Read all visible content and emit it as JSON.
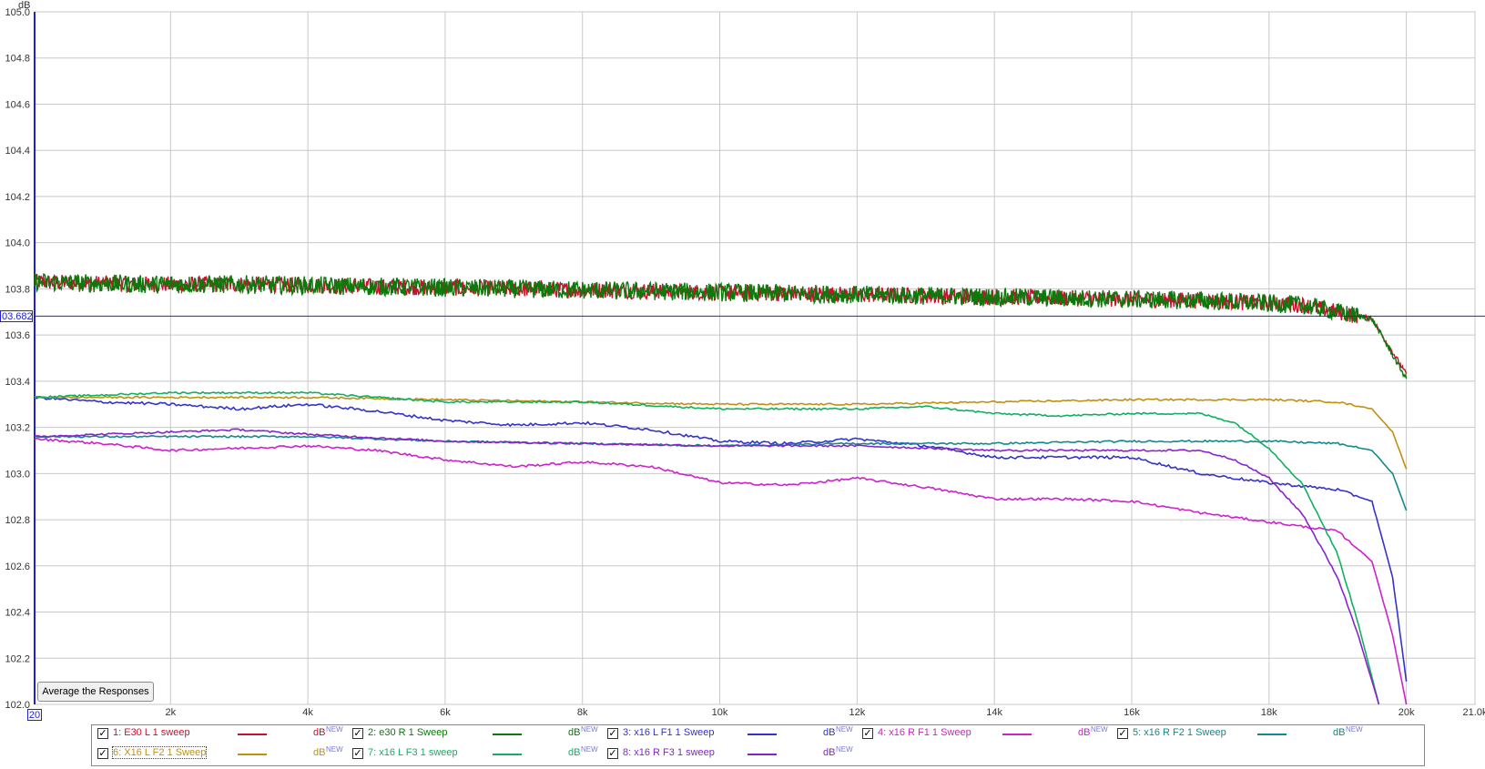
{
  "chart_data": {
    "type": "line",
    "ylabel": "dB",
    "xlim": [
      20,
      21000
    ],
    "ylim": [
      102.0,
      105.0
    ],
    "grid": true,
    "x_ticks": [
      {
        "v": 2000,
        "label": "2k"
      },
      {
        "v": 4000,
        "label": "4k"
      },
      {
        "v": 6000,
        "label": "6k"
      },
      {
        "v": 8000,
        "label": "8k"
      },
      {
        "v": 10000,
        "label": "10k"
      },
      {
        "v": 12000,
        "label": "12k"
      },
      {
        "v": 14000,
        "label": "14k"
      },
      {
        "v": 16000,
        "label": "16k"
      },
      {
        "v": 18000,
        "label": "18k"
      },
      {
        "v": 20000,
        "label": "20k"
      },
      {
        "v": 21000,
        "label": "21.0k"
      }
    ],
    "y_ticks": [
      {
        "v": 105.0,
        "label": "105.0"
      },
      {
        "v": 104.8,
        "label": "104.8"
      },
      {
        "v": 104.6,
        "label": "104.6"
      },
      {
        "v": 104.4,
        "label": "104.4"
      },
      {
        "v": 104.2,
        "label": "104.2"
      },
      {
        "v": 104.0,
        "label": "104.0"
      },
      {
        "v": 103.8,
        "label": "103.8"
      },
      {
        "v": 103.6,
        "label": "103.6"
      },
      {
        "v": 103.4,
        "label": "103.4"
      },
      {
        "v": 103.2,
        "label": "103.2"
      },
      {
        "v": 103.0,
        "label": "103.0"
      },
      {
        "v": 102.8,
        "label": "102.8"
      },
      {
        "v": 102.6,
        "label": "102.6"
      },
      {
        "v": 102.4,
        "label": "102.4"
      },
      {
        "v": 102.2,
        "label": "102.2"
      },
      {
        "v": 102.0,
        "label": "102.0"
      }
    ],
    "cursor_y": 103.682,
    "cursor_label": "03.682",
    "x_start_label": "20",
    "series": [
      {
        "name": "1: E30 L 1 sweep",
        "color": "#c8102e",
        "noise": 0.035,
        "x": [
          20,
          1500,
          3000,
          5000,
          7000,
          9000,
          11000,
          13000,
          15000,
          17000,
          18500,
          19500,
          20000
        ],
        "y": [
          103.83,
          103.82,
          103.82,
          103.81,
          103.8,
          103.79,
          103.78,
          103.77,
          103.76,
          103.75,
          103.73,
          103.67,
          103.43
        ]
      },
      {
        "name": "2: e30 R 1 Sweep",
        "color": "#0a7a0a",
        "noise": 0.04,
        "x": [
          20,
          1500,
          3000,
          5000,
          7000,
          9000,
          11000,
          13000,
          15000,
          17000,
          18500,
          19500,
          20000
        ],
        "y": [
          103.83,
          103.82,
          103.82,
          103.81,
          103.8,
          103.79,
          103.78,
          103.77,
          103.76,
          103.75,
          103.73,
          103.67,
          103.41
        ]
      },
      {
        "name": "3: x16 L F1 1 Sweep",
        "color": "#3333cc",
        "noise": 0.006,
        "x": [
          20,
          1000,
          2000,
          3000,
          4000,
          5000,
          6000,
          7000,
          8000,
          9000,
          10000,
          11000,
          12000,
          13000,
          14000,
          15000,
          16000,
          17000,
          18000,
          19000,
          19500,
          19800,
          20000
        ],
        "y": [
          103.33,
          103.31,
          103.3,
          103.28,
          103.3,
          103.27,
          103.23,
          103.21,
          103.22,
          103.19,
          103.14,
          103.13,
          103.15,
          103.12,
          103.07,
          103.07,
          103.07,
          103.0,
          102.96,
          102.93,
          102.88,
          102.55,
          102.1
        ]
      },
      {
        "name": "4: x16 R F1 1 Sweep",
        "color": "#cc22cc",
        "noise": 0.005,
        "x": [
          20,
          1000,
          2000,
          3000,
          4000,
          5000,
          6000,
          7000,
          8000,
          9000,
          10000,
          11000,
          12000,
          13000,
          14000,
          15000,
          16000,
          17000,
          18000,
          19000,
          19500,
          19800,
          20000
        ],
        "y": [
          103.15,
          103.13,
          103.1,
          103.11,
          103.12,
          103.1,
          103.06,
          103.03,
          103.05,
          103.03,
          102.96,
          102.95,
          102.98,
          102.94,
          102.89,
          102.89,
          102.88,
          102.83,
          102.79,
          102.75,
          102.62,
          102.3,
          102.0
        ]
      },
      {
        "name": "5: x16 R F2 1 Sweep",
        "color": "#128a8a",
        "noise": 0.004,
        "x": [
          20,
          2000,
          4000,
          6000,
          8000,
          10000,
          12000,
          14000,
          16000,
          18000,
          19000,
          19500,
          19800,
          20000
        ],
        "y": [
          103.16,
          103.16,
          103.16,
          103.14,
          103.13,
          103.12,
          103.13,
          103.13,
          103.14,
          103.14,
          103.13,
          103.1,
          103.0,
          102.84
        ]
      },
      {
        "name": "6: X16 L F2 1 Sweep",
        "color": "#c09010",
        "noise": 0.004,
        "x": [
          20,
          2000,
          4000,
          6000,
          8000,
          10000,
          12000,
          14000,
          16000,
          18000,
          19000,
          19500,
          19800,
          20000
        ],
        "y": [
          103.33,
          103.33,
          103.33,
          103.32,
          103.31,
          103.3,
          103.3,
          103.31,
          103.32,
          103.32,
          103.31,
          103.28,
          103.18,
          103.02
        ]
      },
      {
        "name": "7: x16 L F3 1 sweep",
        "color": "#10b060",
        "noise": 0.004,
        "x": [
          20,
          2000,
          4000,
          6000,
          8000,
          10000,
          12000,
          13000,
          14000,
          15000,
          16000,
          17000,
          17500,
          18000,
          18500,
          19000,
          19300,
          19600
        ],
        "y": [
          103.33,
          103.35,
          103.35,
          103.31,
          103.31,
          103.28,
          103.28,
          103.29,
          103.26,
          103.25,
          103.26,
          103.26,
          103.22,
          103.11,
          102.95,
          102.65,
          102.35,
          102.0
        ]
      },
      {
        "name": "8: x16 R F3 1 sweep",
        "color": "#8822cc",
        "noise": 0.004,
        "x": [
          20,
          2000,
          3000,
          4000,
          6000,
          8000,
          10000,
          12000,
          14000,
          16000,
          17000,
          17500,
          18000,
          18500,
          19000,
          19300,
          19600
        ],
        "y": [
          103.16,
          103.18,
          103.19,
          103.17,
          103.14,
          103.13,
          103.12,
          103.12,
          103.1,
          103.1,
          103.1,
          103.06,
          102.98,
          102.82,
          102.55,
          102.3,
          102.0
        ]
      }
    ]
  },
  "controls": {
    "average_button": "Average the Responses"
  },
  "legend": {
    "unit": "dB",
    "unit_sup": "NEW",
    "items": [
      {
        "label": "1: E30 L 1 sweep",
        "color": "#c8102e",
        "checked": "✓"
      },
      {
        "label": "2: e30 R 1 Sweep",
        "color": "#0a7a0a",
        "checked": "✓"
      },
      {
        "label": "3: x16 L F1 1 Sweep",
        "color": "#3333cc",
        "checked": "✓"
      },
      {
        "label": "4: x16 R F1 1 Sweep",
        "color": "#cc22cc",
        "checked": "✓"
      },
      {
        "label": "5: x16 R F2 1 Sweep",
        "color": "#128a8a",
        "checked": "✓"
      },
      {
        "label": "6: X16 L F2 1 Sweep",
        "color": "#c09010",
        "checked": "✓"
      },
      {
        "label": "7: x16 L F3 1 sweep",
        "color": "#10b060",
        "checked": "✓"
      },
      {
        "label": "8: x16 R F3 1 sweep",
        "color": "#8822cc",
        "checked": "✓"
      }
    ]
  }
}
